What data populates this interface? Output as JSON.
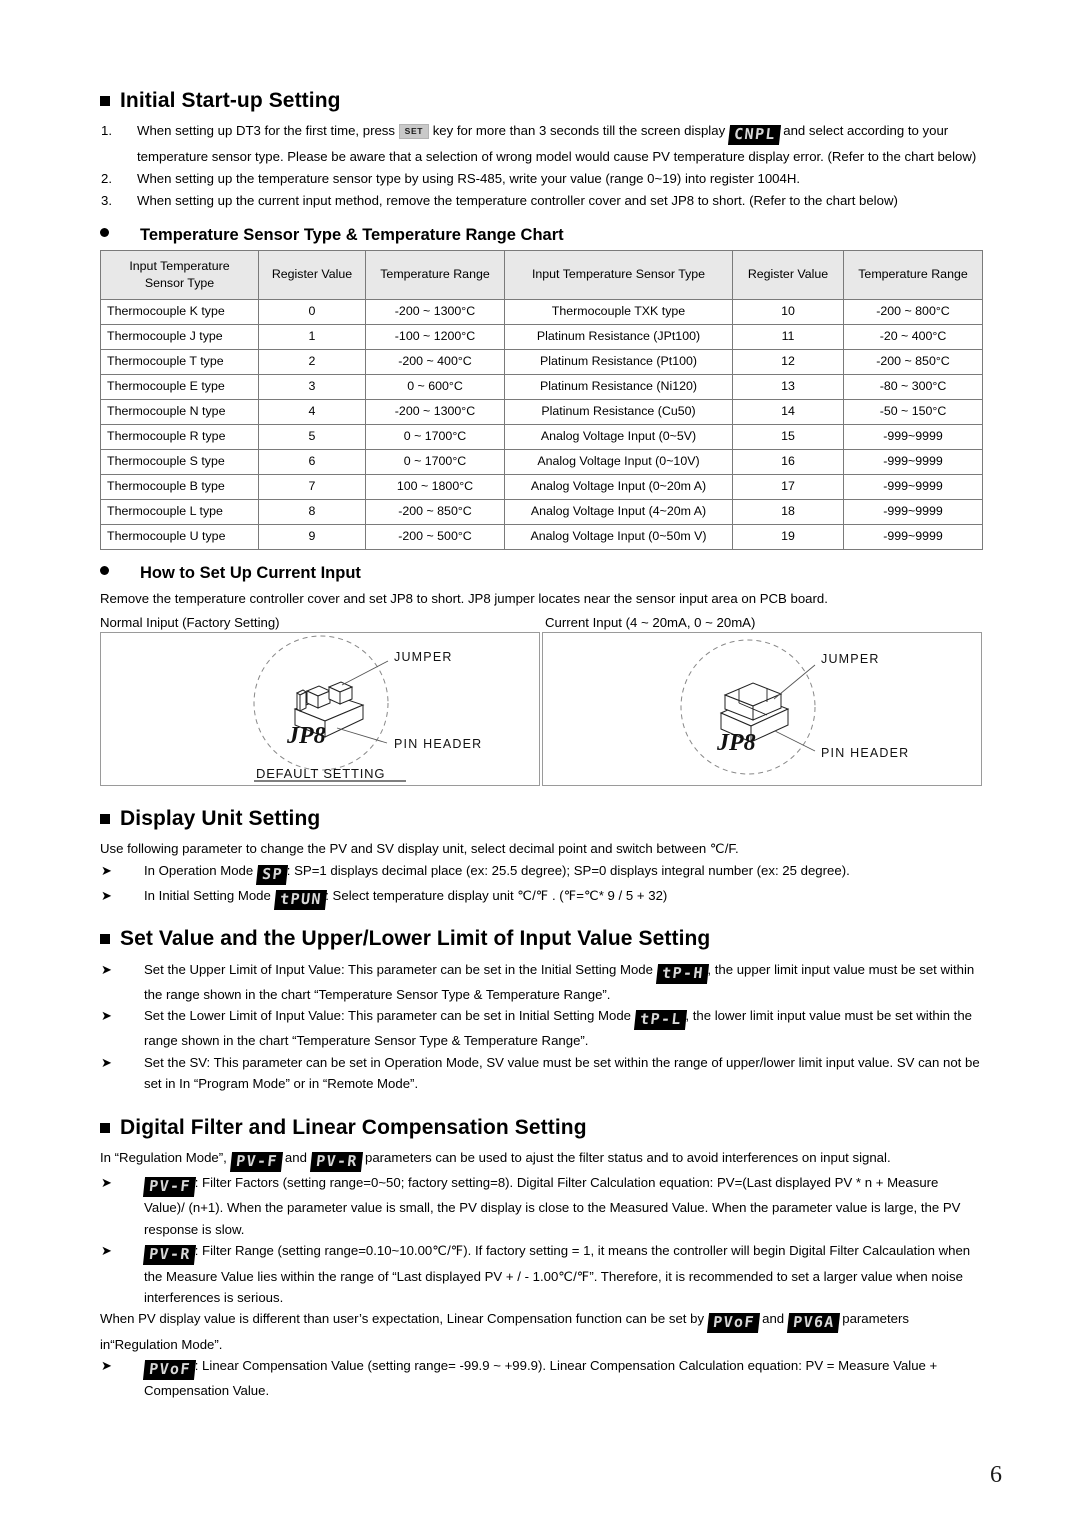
{
  "page": {
    "number": "6"
  },
  "sections": {
    "initial_startup": {
      "heading": "Initial Start-up Setting",
      "items": [
        {
          "num": "1.",
          "part1": "When setting up DT3 for the first time, press",
          "key_label": "SET",
          "part2": "key for more than 3 seconds till the screen display",
          "lcd": "CNPL",
          "part3": "and select according to your temperature sensor type. Please be aware that a selection of wrong model would cause PV temperature display error. (Refer to the chart below)"
        },
        {
          "num": "2.",
          "text": "When setting up the temperature sensor type by using RS-485, write your value (range 0~19) into register 1004H."
        },
        {
          "num": "3.",
          "text": "When setting up the current input method, remove the temperature controller cover and set JP8 to short.   (Refer to the chart below)"
        }
      ]
    },
    "sensor_chart": {
      "bullet_title": "Temperature Sensor Type & Temperature Range Chart",
      "headers": [
        "Input Temperature Sensor Type",
        "Register Value",
        "Temperature Range",
        "Input Temperature Sensor Type",
        "Register Value",
        "Temperature Range"
      ],
      "header_line1": "Input Temperature",
      "header_line2": "Sensor Type",
      "rows": [
        [
          "Thermocouple K type",
          "0",
          "-200 ~ 1300°C",
          "Thermocouple TXK type",
          "10",
          "-200 ~ 800°C"
        ],
        [
          "Thermocouple J type",
          "1",
          "-100 ~ 1200°C",
          "Platinum Resistance (JPt100)",
          "11",
          "-20 ~ 400°C"
        ],
        [
          "Thermocouple T type",
          "2",
          "-200 ~ 400°C",
          "Platinum Resistance (Pt100)",
          "12",
          "-200 ~ 850°C"
        ],
        [
          "Thermocouple E type",
          "3",
          "0 ~ 600°C",
          "Platinum Resistance (Ni120)",
          "13",
          "-80 ~ 300°C"
        ],
        [
          "Thermocouple N type",
          "4",
          "-200 ~ 1300°C",
          "Platinum Resistance (Cu50)",
          "14",
          "-50 ~ 150°C"
        ],
        [
          "Thermocouple R type",
          "5",
          "0 ~ 1700°C",
          "Analog Voltage Input (0~5V)",
          "15",
          "-999~9999"
        ],
        [
          "Thermocouple S type",
          "6",
          "0 ~ 1700°C",
          "Analog Voltage Input (0~10V)",
          "16",
          "-999~9999"
        ],
        [
          "Thermocouple B type",
          "7",
          "100 ~ 1800°C",
          "Analog Voltage Input (0~20m A)",
          "17",
          "-999~9999"
        ],
        [
          "Thermocouple L type",
          "8",
          "-200 ~ 850°C",
          "Analog Voltage Input (4~20m A)",
          "18",
          "-999~9999"
        ],
        [
          "Thermocouple U type",
          "9",
          "-200 ~ 500°C",
          "Analog Voltage Input (0~50m V)",
          "19",
          "-999~9999"
        ]
      ]
    },
    "current_input": {
      "bullet_title": "How to Set Up Current Input",
      "intro": "Remove the temperature controller cover and set JP8 to short. JP8 jumper locates near the sensor input area on PCB board.",
      "left_caption": "Normal Iniput (Factory Setting)",
      "right_caption": "Current Input (4 ~ 20mA, 0 ~ 20mA)",
      "diagram_left": {
        "jumper_label": "JUMPER",
        "pin_header_label": "PIN HEADER",
        "part_label": "JP8",
        "footer_label": "DEFAULT SETTING"
      },
      "diagram_right": {
        "jumper_label": "JUMPER",
        "pin_header_label": "PIN HEADER",
        "part_label": "JP8"
      }
    },
    "display_unit": {
      "heading": "Display Unit Setting",
      "intro": "Use following parameter to change the PV and SV display unit,   select decimal point and switch between ℃/F.",
      "items": [
        {
          "pre": "In Operation Mode",
          "lcd": "SP",
          "post": ": SP=1 displays decimal place (ex: 25.5 degree); SP=0 displays integral number (ex: 25 degree)."
        },
        {
          "pre": "In Initial Setting Mode",
          "lcd": "tPUN",
          "post": ": Select temperature display unit ℃/℉ . (℉=℃* 9 / 5 + 32)"
        }
      ]
    },
    "set_value": {
      "heading": "Set Value and the Upper/Lower Limit of Input Value Setting",
      "items": [
        {
          "pre": "Set the Upper Limit of Input Value: This parameter can be set in the Initial Setting Mode",
          "lcd": "tP-H",
          "post": ", the upper limit input value must be set within the range shown in the chart “Temperature Sensor Type & Temperature Range”."
        },
        {
          "pre": "Set the Lower Limit of Input Value: This parameter can be set in Initial Setting Mode",
          "lcd": "tP-L",
          "post": ", the lower limit input value must be set within the range shown in the chart “Temperature Sensor Type & Temperature Range”."
        },
        {
          "pre": "",
          "lcd": "",
          "post": "Set the SV: This parameter can be set in Operation Mode, SV value must be set within the range of upper/lower limit input value. SV can not be set in In “Program Mode” or in “Remote Mode”."
        }
      ]
    },
    "digital_filter": {
      "heading": "Digital Filter and Linear Compensation Setting",
      "intro_part1": "In “Regulation Mode”,",
      "intro_lcd1": "PV-F",
      "intro_and": "and",
      "intro_lcd2": "PV-R",
      "intro_part2": "parameters can be used to ajust the filter status and to avoid interferences on input signal.",
      "items": [
        {
          "lcd": "PV-F",
          "text": ": Filter Factors (setting range=0~50; factory setting=8). Digital Filter Calculation equation: PV=(Last displayed PV * n + Measure Value)/ (n+1). When the parameter value is small, the PV display is close to the Measured Value. When the parameter value is large, the PV response is slow."
        },
        {
          "lcd": "PV-R",
          "text": ": Filter Range (setting range=0.10~10.00℃/℉). If factory setting = 1, it means the controller will begin Digital Filter Calcaulation when the Measure Value lies within the range of “Last displayed PV + / - 1.00℃/℉”. Therefore, it is recommended to set a larger value when noise interferences is serious."
        }
      ],
      "linear_part1": "When PV display value is different than user’s expectation, Linear Compensation function can be set by",
      "linear_lcd1": "PVoF",
      "linear_and": "and",
      "linear_lcd2": "PV6A",
      "linear_part2": "parameters in“Regulation Mode”.",
      "final_item": {
        "lcd": "PVoF",
        "text": ": Linear Compensation Value (setting range= -99.9 ~ +99.9). Linear Compensation Calculation equation: PV = Measure Value + Compensation Value."
      }
    }
  }
}
